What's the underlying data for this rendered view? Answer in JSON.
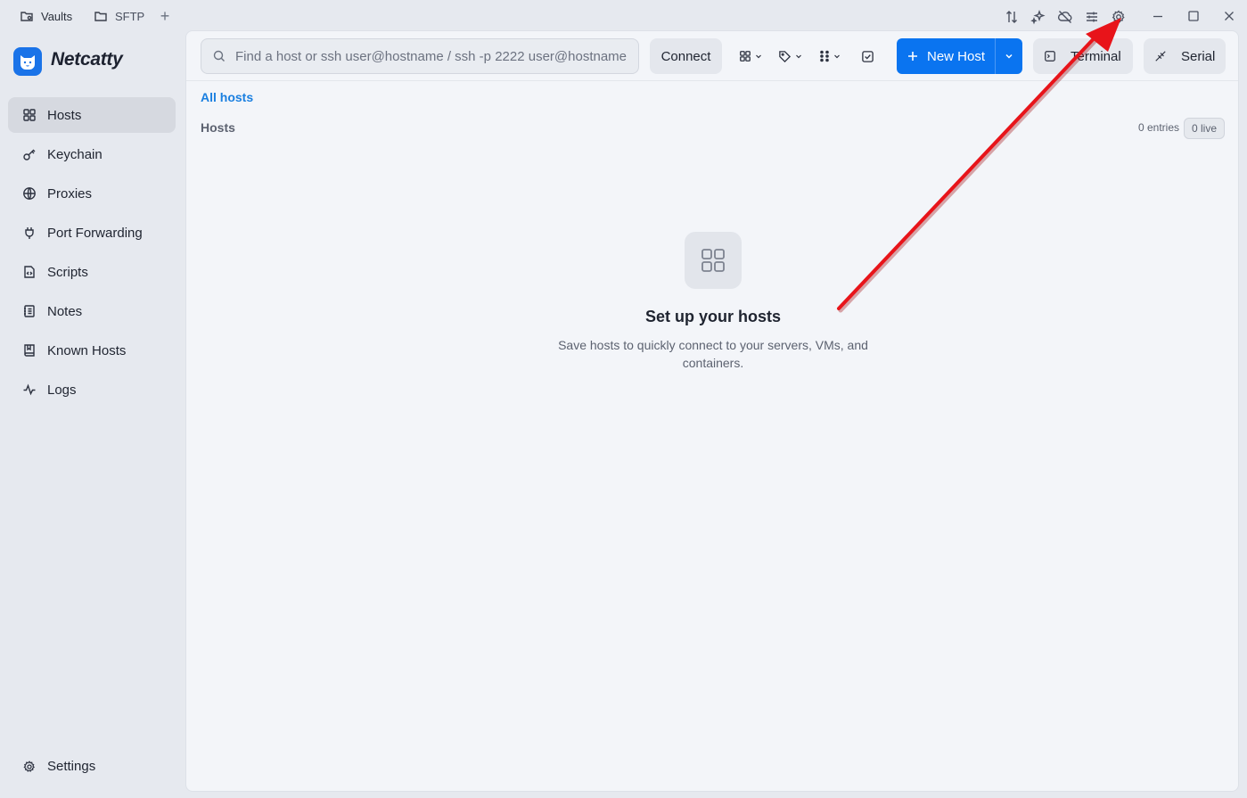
{
  "titlebar": {
    "tabs": [
      {
        "label": "Vaults",
        "icon": "vault-folder-icon"
      },
      {
        "label": "SFTP",
        "icon": "folder-icon"
      }
    ],
    "add_tab": "+",
    "right_icons": [
      "transfer-icon",
      "sparkle-icon",
      "cloud-off-icon",
      "sliders-icon",
      "gear-icon"
    ],
    "window_controls": [
      "minimize-icon",
      "maximize-icon",
      "close-icon"
    ]
  },
  "sidebar": {
    "brand": "Netcatty",
    "items": [
      {
        "label": "Hosts",
        "icon": "grid-icon",
        "active": true
      },
      {
        "label": "Keychain",
        "icon": "key-icon"
      },
      {
        "label": "Proxies",
        "icon": "globe-icon"
      },
      {
        "label": "Port Forwarding",
        "icon": "plug-icon"
      },
      {
        "label": "Scripts",
        "icon": "script-file-icon"
      },
      {
        "label": "Notes",
        "icon": "notebook-icon"
      },
      {
        "label": "Known Hosts",
        "icon": "book-icon"
      },
      {
        "label": "Logs",
        "icon": "activity-icon"
      }
    ],
    "settings_label": "Settings"
  },
  "toolbar": {
    "search_placeholder": "Find a host or ssh user@hostname / ssh -p 2222 user@hostname...",
    "connect_label": "Connect",
    "new_host_label": "New Host",
    "terminal_label": "Terminal",
    "serial_label": "Serial"
  },
  "content": {
    "breadcrumb": "All hosts",
    "section_title": "Hosts",
    "entries": "0 entries",
    "live": "0 live",
    "empty_title": "Set up your hosts",
    "empty_desc": "Save hosts to quickly connect to your servers, VMs, and containers."
  },
  "colors": {
    "accent": "#0a74f0",
    "link": "#1a7fe0",
    "annotation_arrow": "#e8141a"
  }
}
